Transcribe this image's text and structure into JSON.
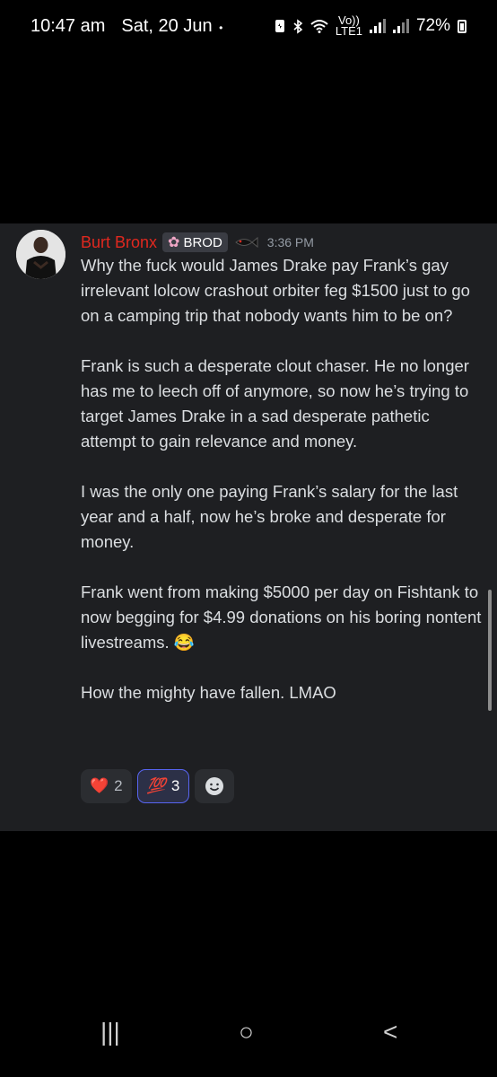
{
  "status": {
    "time": "10:47 am",
    "date": "Sat, 20 Jun",
    "dot": "•",
    "volte_top": "Vo))",
    "volte_bottom": "LTE1",
    "battery": "72%"
  },
  "message": {
    "username": "Burt Bronx",
    "role_tag": "BROD",
    "timestamp": "3:36 PM",
    "paragraphs": [
      "Why the fuck would James Drake pay Frank’s gay irrelevant lolcow crashout orbiter feg $1500 just to go on a camping trip that nobody wants him to be on?",
      "Frank is such a desperate clout chaser. He no longer has me to leech off of anymore, so now he’s trying to target James Drake in a sad desperate pathetic attempt to gain relevance and money.",
      "I was the only one paying Frank’s salary for the last year and a half, now he’s broke and desperate for money.",
      "Frank went from making $5000 per day on Fishtank to now begging for $4.99 donations on his boring nontent  livestreams. 😂",
      "How the mighty have fallen. LMAO"
    ]
  },
  "reactions": [
    {
      "emoji": "❤️",
      "count": "2"
    },
    {
      "emoji": "💯",
      "count": "3"
    }
  ],
  "colors": {
    "username": "#e0281f",
    "message_bg": "#1e1f22",
    "active_reaction_border": "#5865f2"
  },
  "nav": {
    "recents_icon": "|||",
    "home_icon": "○",
    "back_icon": "<"
  }
}
